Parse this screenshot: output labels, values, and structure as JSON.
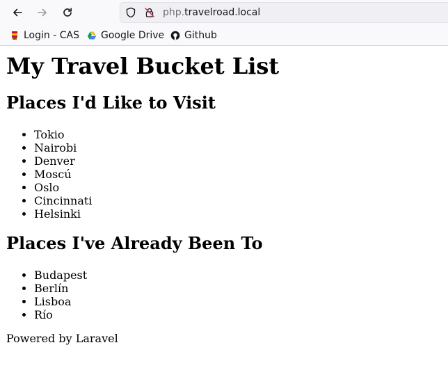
{
  "browser": {
    "url_host_prefix": "php.",
    "url_host_main": "travelroad.local",
    "bookmarks": [
      {
        "label": "Login - CAS",
        "icon": "cas-icon"
      },
      {
        "label": "Google Drive",
        "icon": "google-drive-icon"
      },
      {
        "label": "Github",
        "icon": "github-icon"
      }
    ]
  },
  "page": {
    "title": "My Travel Bucket List",
    "wish": {
      "heading": "Places I'd Like to Visit",
      "items": [
        "Tokio",
        "Nairobi",
        "Denver",
        "Moscú",
        "Oslo",
        "Cincinnati",
        "Helsinki"
      ]
    },
    "visited": {
      "heading": "Places I've Already Been To",
      "items": [
        "Budapest",
        "Berlín",
        "Lisboa",
        "Río"
      ]
    },
    "footer": "Powered by Laravel"
  }
}
